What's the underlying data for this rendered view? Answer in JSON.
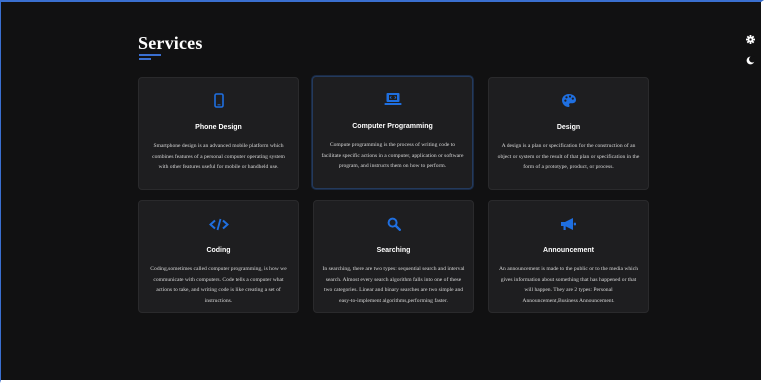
{
  "section": {
    "title": "Services"
  },
  "colors": {
    "background": "#111112",
    "card": "#1e1e20",
    "accent": "#1f6fe0",
    "text": "#ffffff"
  },
  "services": [
    {
      "icon": "mobile-phone-icon",
      "name": "Phone Design",
      "description": "Smartphone design is an advanced mobile platform which combines features of a personal computer operating system with other features useful for mobile or handheld use."
    },
    {
      "icon": "laptop-code-icon",
      "name": "Computer Programming",
      "description": "Compute programming is the process of writing code to facilitate specific actions in a computer, application or software program, and instructs them on how to perform."
    },
    {
      "icon": "palette-icon",
      "name": "Design",
      "description": "A design is a plan or specification for the construction of an object or system or the result of that plan or specification in the form of a prototype, product, or process."
    },
    {
      "icon": "code-icon",
      "name": "Coding",
      "description": "Coding,sometimes called computer programming, is how we communicate with computers. Code tells a computer what actions to take, and writing code is like creating a set of instructions."
    },
    {
      "icon": "search-icon",
      "name": "Searching",
      "description": "In searching, there are two types: sequential search and interval search. Almost every search algorithm falls into one of these two categories. Linear and binary searches are two simple and easy-to-implement algorithms,performing faster."
    },
    {
      "icon": "megaphone-icon",
      "name": "Announcement",
      "description": "An announcement is made to the public or to the media which gives information about something that has happened or that will happen. They are 2 types: Personal Announcement,Business Announcement."
    }
  ],
  "controls": {
    "settings_icon": "gear-icon",
    "theme_icon": "moon-icon"
  }
}
